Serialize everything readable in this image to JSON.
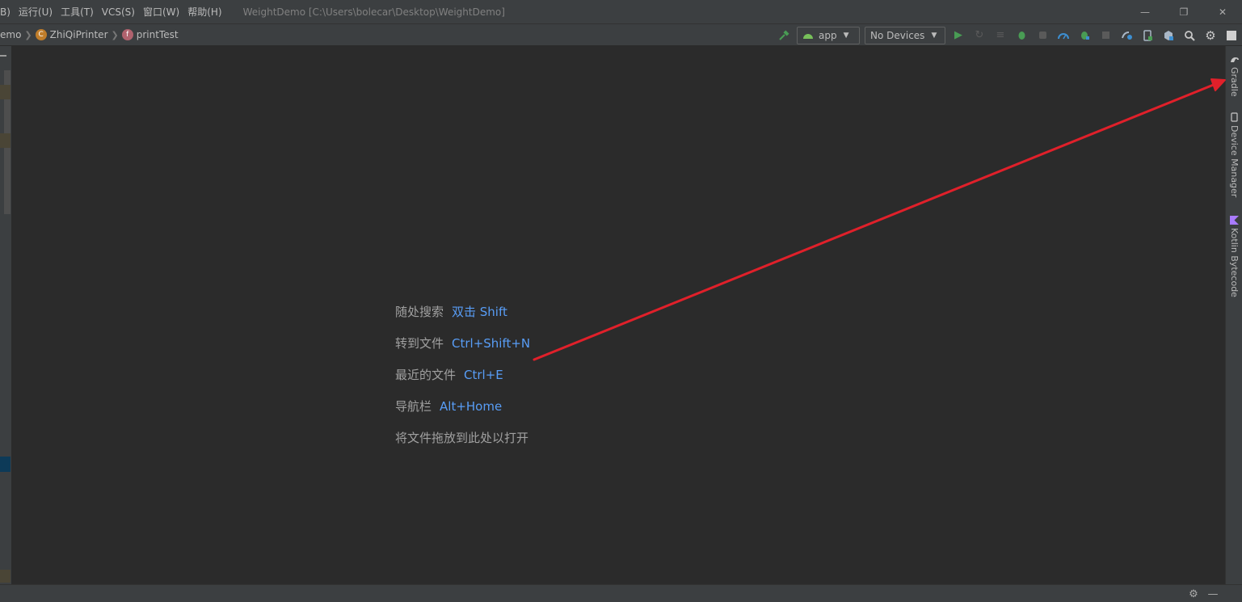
{
  "menu": {
    "items": [
      "B)",
      "运行(U)",
      "工具(T)",
      "VCS(S)",
      "窗口(W)",
      "帮助(H)"
    ],
    "window_title": "WeightDemo [C:\\Users\\bolecar\\Desktop\\WeightDemo]",
    "minimize": "—",
    "restore": "❐",
    "close": "✕"
  },
  "breadcrumb": {
    "project": "emo",
    "file": "ZhiQiPrinter",
    "function": "printTest",
    "function_badge": "f"
  },
  "toolbar": {
    "config": "app",
    "device": "No Devices"
  },
  "editor": {
    "hints": [
      {
        "label": "随处搜索",
        "shortcut": "双击 Shift"
      },
      {
        "label": "转到文件",
        "shortcut": "Ctrl+Shift+N"
      },
      {
        "label": "最近的文件",
        "shortcut": "Ctrl+E"
      },
      {
        "label": "导航栏",
        "shortcut": "Alt+Home"
      }
    ],
    "drop_hint": "将文件拖放到此处以打开"
  },
  "right_tools": [
    {
      "label": "Gradle",
      "icon": "gradle-icon"
    },
    {
      "label": "Device Manager",
      "icon": "device-manager-icon"
    },
    {
      "label": "Kotlin Bytecode",
      "icon": "kotlin-icon"
    }
  ],
  "colors": {
    "shortcut": "#589df6",
    "annotation_arrow": "#e0202a",
    "run_green": "#499c54"
  }
}
